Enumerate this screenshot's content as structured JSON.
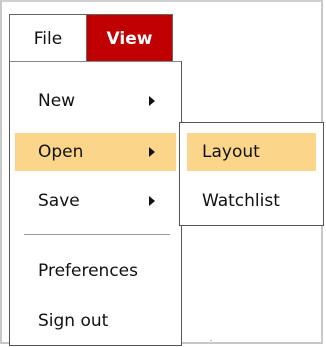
{
  "menubar": {
    "items": [
      {
        "label": "File"
      },
      {
        "label": "View"
      }
    ],
    "active_color": "#c00000"
  },
  "dropdown": {
    "items": [
      {
        "label": "New",
        "has_submenu": true
      },
      {
        "label": "Open",
        "has_submenu": true,
        "highlighted": true
      },
      {
        "label": "Save",
        "has_submenu": true
      },
      {
        "label": "Preferences",
        "has_submenu": false
      },
      {
        "label": "Sign out",
        "has_submenu": false
      }
    ],
    "highlight_color": "#fbd68a"
  },
  "submenu": {
    "items": [
      {
        "label": "Layout",
        "highlighted": true
      },
      {
        "label": "Watchlist"
      }
    ]
  },
  "icons": {
    "submenu_arrow": "chevron-right-icon"
  }
}
